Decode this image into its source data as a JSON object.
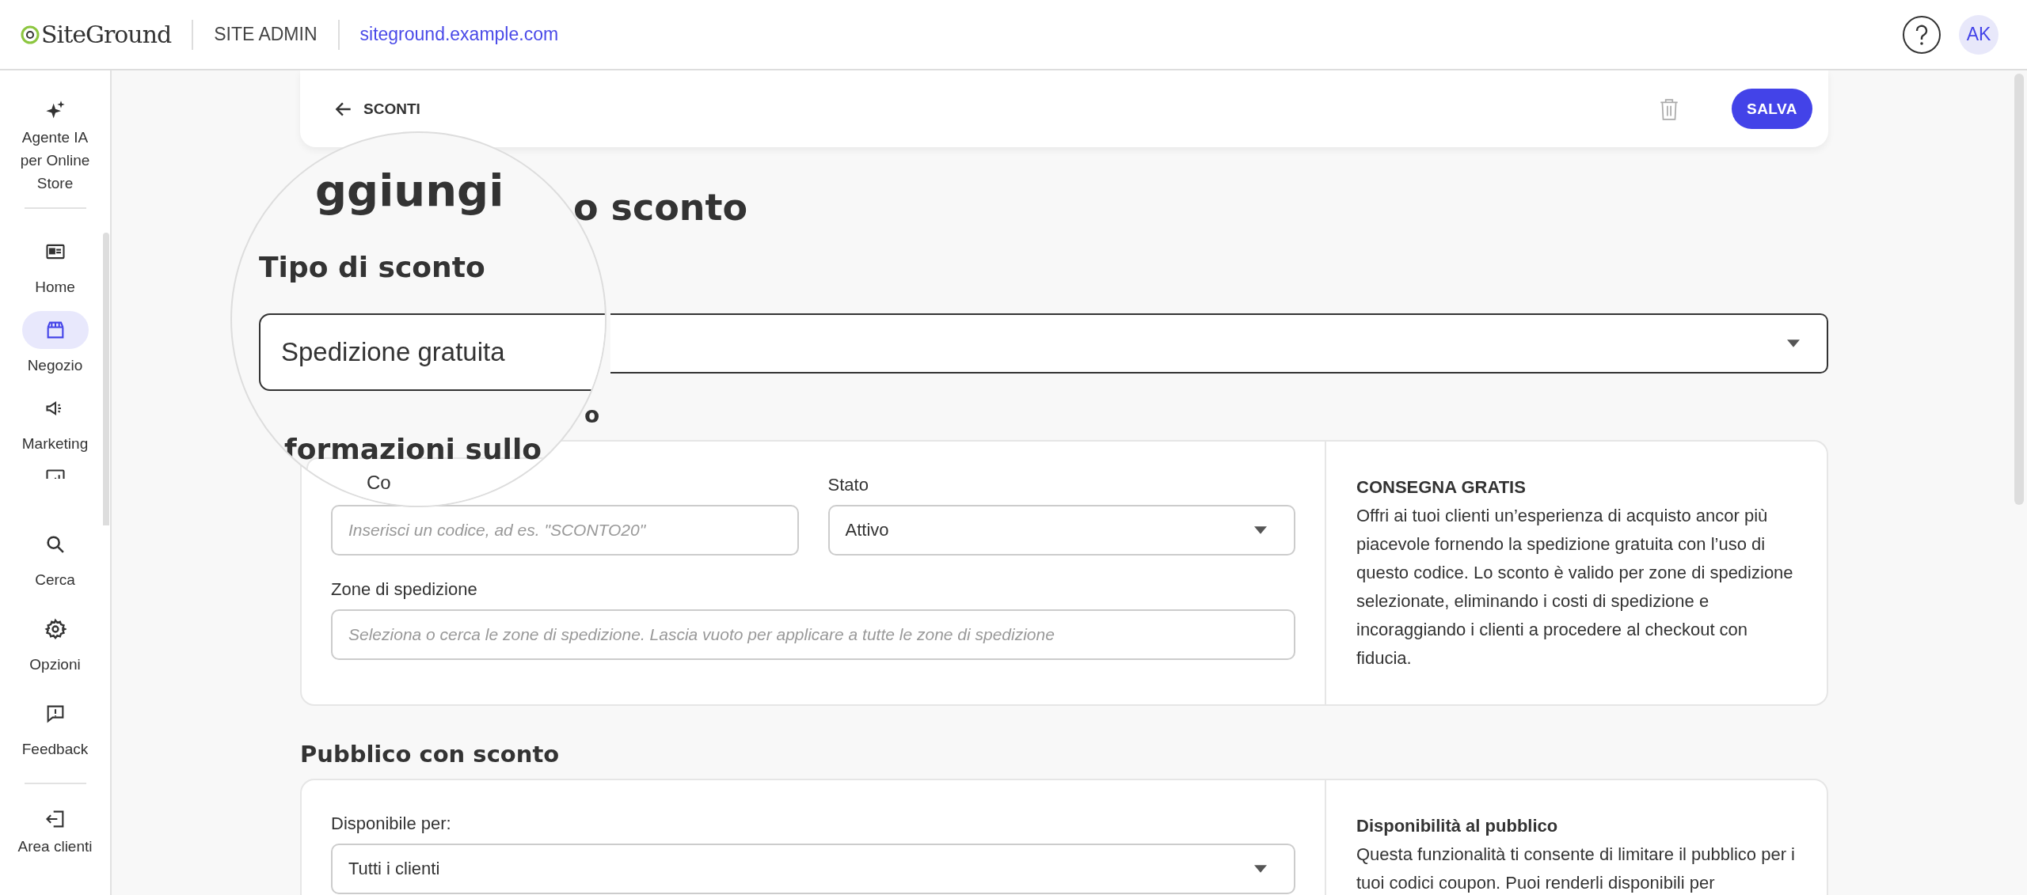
{
  "topbar": {
    "logo": "SiteGround",
    "section": "SITE ADMIN",
    "domain": "siteground.example.com",
    "avatar": "AK"
  },
  "sidebar": {
    "top_item": {
      "label": "Agente IA per Online Store",
      "selected": false
    },
    "items": [
      {
        "label": "Home",
        "selected": false
      },
      {
        "label": "Negozio",
        "selected": true
      },
      {
        "label": "Marketing",
        "selected": false
      }
    ],
    "bottom_items": [
      {
        "label": "Cerca",
        "selected": false
      },
      {
        "label": "Opzioni",
        "selected": false
      },
      {
        "label": "Feedback",
        "selected": false
      }
    ],
    "footer_item": {
      "label": "Area clienti",
      "selected": false
    }
  },
  "header": {
    "back": "SCONTI",
    "save": "SALVA"
  },
  "page_title_visible": "o sconto",
  "info_heading_visible": "o",
  "magnifier": {
    "title": "ggiungi",
    "section": "Tipo di sconto",
    "select_value": "Spedizione gratuita",
    "info_heading": "formazioni sullo",
    "field_label": "Co"
  },
  "info_card": {
    "code_placeholder": "Inserisci un codice, ad es. \"SCONTO20\"",
    "status_label": "Stato",
    "status_value": "Attivo",
    "zones_label": "Zone di spedizione",
    "zones_placeholder": "Seleziona o cerca le zone di spedizione. Lascia vuoto per applicare a tutte le zone di spedizione",
    "help_title": "CONSEGNA GRATIS",
    "help_text": "Offri ai tuoi clienti un’esperienza di acquisto ancor più piacevole fornendo la spedizione gratuita con l’uso di questo codice. Lo sconto è valido per zone di spedizione selezionate, eliminando i costi di spedizione e incoraggiando i clienti a procedere al checkout con fiducia."
  },
  "audience_heading": "Pubblico con sconto",
  "audience_card": {
    "label": "Disponibile per:",
    "value": "Tutti i clienti",
    "help_title": "Disponibilità al pubblico",
    "help_text": "Questa funzionalità ti consente di limitare il pubblico per i tuoi codici coupon. Puoi renderli disponibili per"
  }
}
